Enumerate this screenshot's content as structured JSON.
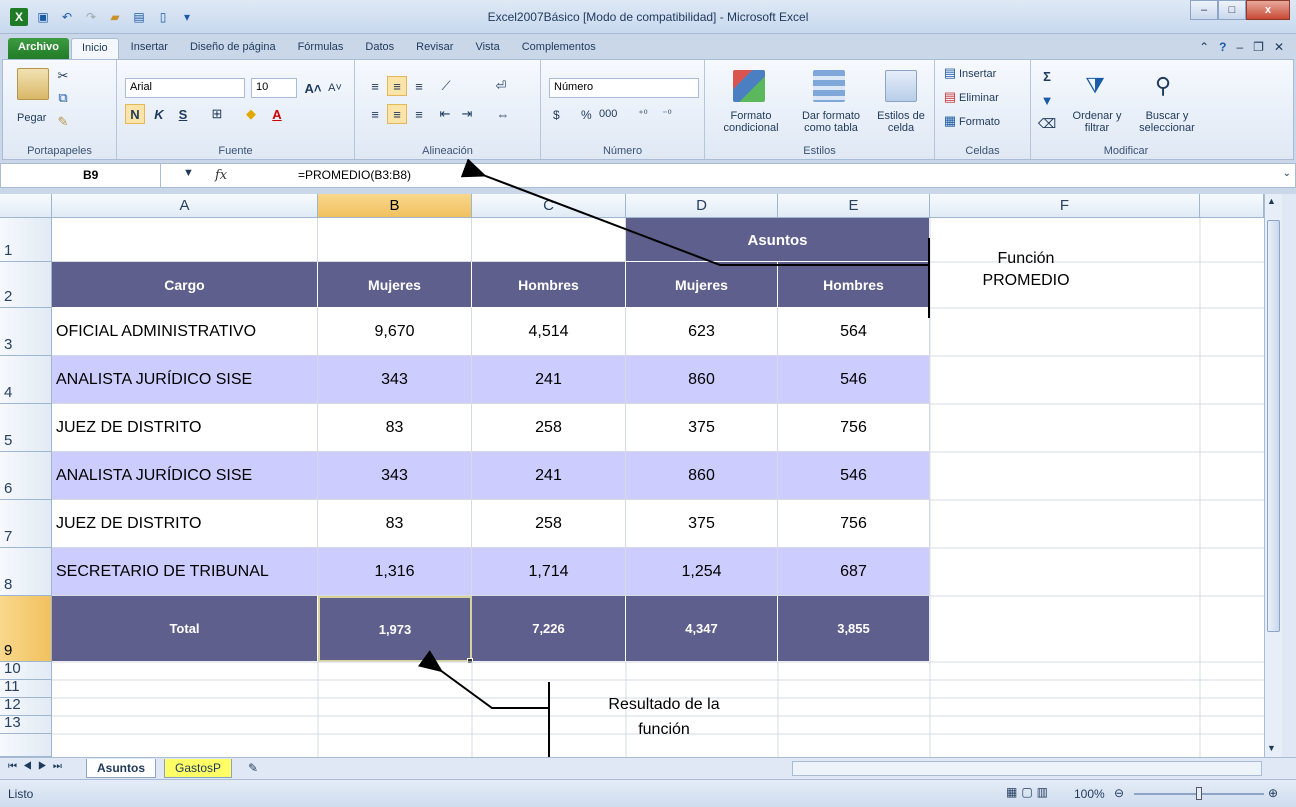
{
  "window": {
    "title": "Excel2007Básico  [Modo de compatibilidad]  -  Microsoft Excel",
    "minimize": "–",
    "maximize": "□",
    "close": "x"
  },
  "ribbon_tabs": [
    "Archivo",
    "Inicio",
    "Insertar",
    "Diseño de página",
    "Fórmulas",
    "Datos",
    "Revisar",
    "Vista",
    "Complementos"
  ],
  "ribbon": {
    "clipboard": {
      "paste": "Pegar",
      "label": "Portapapeles"
    },
    "font": {
      "name": "Arial",
      "size": "10",
      "bold": "N",
      "italic": "K",
      "underline": "S",
      "label": "Fuente"
    },
    "alignment": {
      "label": "Alineación"
    },
    "number": {
      "format": "Número",
      "currency": "$",
      "percent": "%",
      "thousands": "000",
      "label": "Número"
    },
    "styles": {
      "conditional": "Formato condicional",
      "table": "Dar formato como tabla",
      "cell_styles": "Estilos de celda",
      "label": "Estilos"
    },
    "cells": {
      "insert": "Insertar",
      "delete": "Eliminar",
      "format": "Formato",
      "label": "Celdas"
    },
    "editing": {
      "sort": "Ordenar y filtrar",
      "find": "Buscar y seleccionar",
      "label": "Modificar"
    }
  },
  "formula_bar": {
    "name_box": "B9",
    "fx": "fx",
    "formula": "=PROMEDIO(B3:B8)"
  },
  "columns": [
    "A",
    "B",
    "C",
    "D",
    "E",
    "F"
  ],
  "rows": [
    "1",
    "2",
    "3",
    "4",
    "5",
    "6",
    "7",
    "8",
    "9",
    "10",
    "11",
    "12",
    "13"
  ],
  "sheet": {
    "merged_header": "Asuntos",
    "headers": [
      "Cargo",
      "Mujeres",
      "Hombres",
      "Mujeres",
      "Hombres"
    ],
    "data": [
      [
        "OFICIAL ADMINISTRATIVO",
        "9,670",
        "4,514",
        "623",
        "564"
      ],
      [
        "ANALISTA JURÍDICO SISE",
        "343",
        "241",
        "860",
        "546"
      ],
      [
        "JUEZ DE DISTRITO",
        "83",
        "258",
        "375",
        "756"
      ],
      [
        "ANALISTA JURÍDICO SISE",
        "343",
        "241",
        "860",
        "546"
      ],
      [
        "JUEZ DE DISTRITO",
        "83",
        "258",
        "375",
        "756"
      ],
      [
        "SECRETARIO DE TRIBUNAL",
        "1,316",
        "1,714",
        "1,254",
        "687"
      ]
    ],
    "total": [
      "Total",
      "1,973",
      "7,226",
      "4,347",
      "3,855"
    ]
  },
  "annotations": {
    "function_line1": "Función",
    "function_line2": "PROMEDIO",
    "result_line1": "Resultado de la",
    "result_line2": "función"
  },
  "sheet_tabs": [
    "Asuntos",
    "GastosP"
  ],
  "status": {
    "ready": "Listo",
    "zoom": "100%"
  },
  "colors": {
    "header_purple": "#5f5f8d",
    "band_lavender": "#ccccff",
    "selected_header": "#f1c15f",
    "file_tab_green": "#1f7b25"
  }
}
